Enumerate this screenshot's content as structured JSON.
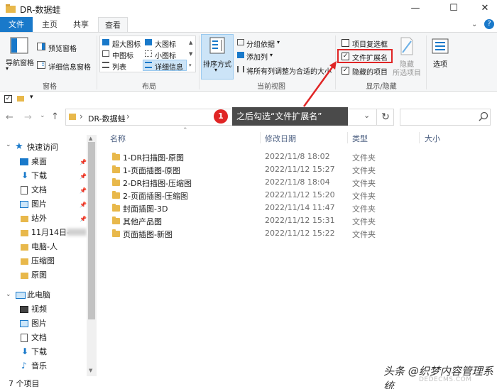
{
  "window": {
    "title": "DR-数据蛙",
    "minimize": "—",
    "maximize": "☐",
    "close": "✕"
  },
  "ribbon_tabs": [
    "文件",
    "主页",
    "共享",
    "查看"
  ],
  "ribbon": {
    "pane": {
      "nav_pane": "导航窗格",
      "preview": "预览窗格",
      "details": "详细信息窗格",
      "label": "窗格"
    },
    "layout": {
      "items": [
        "超大图标",
        "大图标",
        "中图标",
        "小图标",
        "列表",
        "详细信息"
      ],
      "label": "布局"
    },
    "current_view": {
      "sort": "排序方式",
      "group": "分组依据",
      "add_col": "添加列",
      "fit": "将所有列调整为合适的大小",
      "label": "当前视图"
    },
    "show_hide": {
      "item_checkbox": "项目复选框",
      "file_ext": "文件扩展名",
      "hidden_items": "隐藏的项目",
      "hide": "隐藏",
      "hide_selected": "所选项目",
      "label": "显示/隐藏",
      "options": "选项"
    }
  },
  "address": {
    "path": "DR-数据蛙",
    "sep": "›",
    "refresh": "↻",
    "dropdown": "⌄"
  },
  "callout": {
    "num": "1",
    "text": "之后勾选“文件扩展名”"
  },
  "nav": {
    "quick_access": "快速访问",
    "items": [
      {
        "label": "桌面",
        "pinned": true
      },
      {
        "label": "下载",
        "pinned": true
      },
      {
        "label": "文档",
        "pinned": true
      },
      {
        "label": "图片",
        "pinned": true
      },
      {
        "label": "站外",
        "pinned": true
      },
      {
        "label": "11月14日-",
        "pinned": false
      },
      {
        "label": "电脑-人",
        "pinned": false
      },
      {
        "label": "压缩图",
        "pinned": false
      },
      {
        "label": "原图",
        "pinned": false
      }
    ],
    "this_pc": "此电脑",
    "pc_items": [
      "视频",
      "图片",
      "文档",
      "下载",
      "音乐"
    ]
  },
  "columns": {
    "name": "名称",
    "date": "修改日期",
    "type": "类型",
    "size": "大小"
  },
  "files": [
    {
      "name": "1-DR扫描图-原图",
      "date": "2022/11/8 18:02",
      "type": "文件夹"
    },
    {
      "name": "1-页面插图-原图",
      "date": "2022/11/12 15:27",
      "type": "文件夹"
    },
    {
      "name": "2-DR扫描图-压缩图",
      "date": "2022/11/8 18:04",
      "type": "文件夹"
    },
    {
      "name": "2-页面插图-压缩图",
      "date": "2022/11/12 15:20",
      "type": "文件夹"
    },
    {
      "name": "封面插图-3D",
      "date": "2022/11/14 11:47",
      "type": "文件夹"
    },
    {
      "name": "其他产品图",
      "date": "2022/11/12 15:31",
      "type": "文件夹"
    },
    {
      "name": "页面插图-新图",
      "date": "2022/11/12 15:22",
      "type": "文件夹"
    }
  ],
  "status": "7 个项目",
  "watermark": "头条 @织梦内容管理系统",
  "watermark2": "DEDECMS.COM"
}
